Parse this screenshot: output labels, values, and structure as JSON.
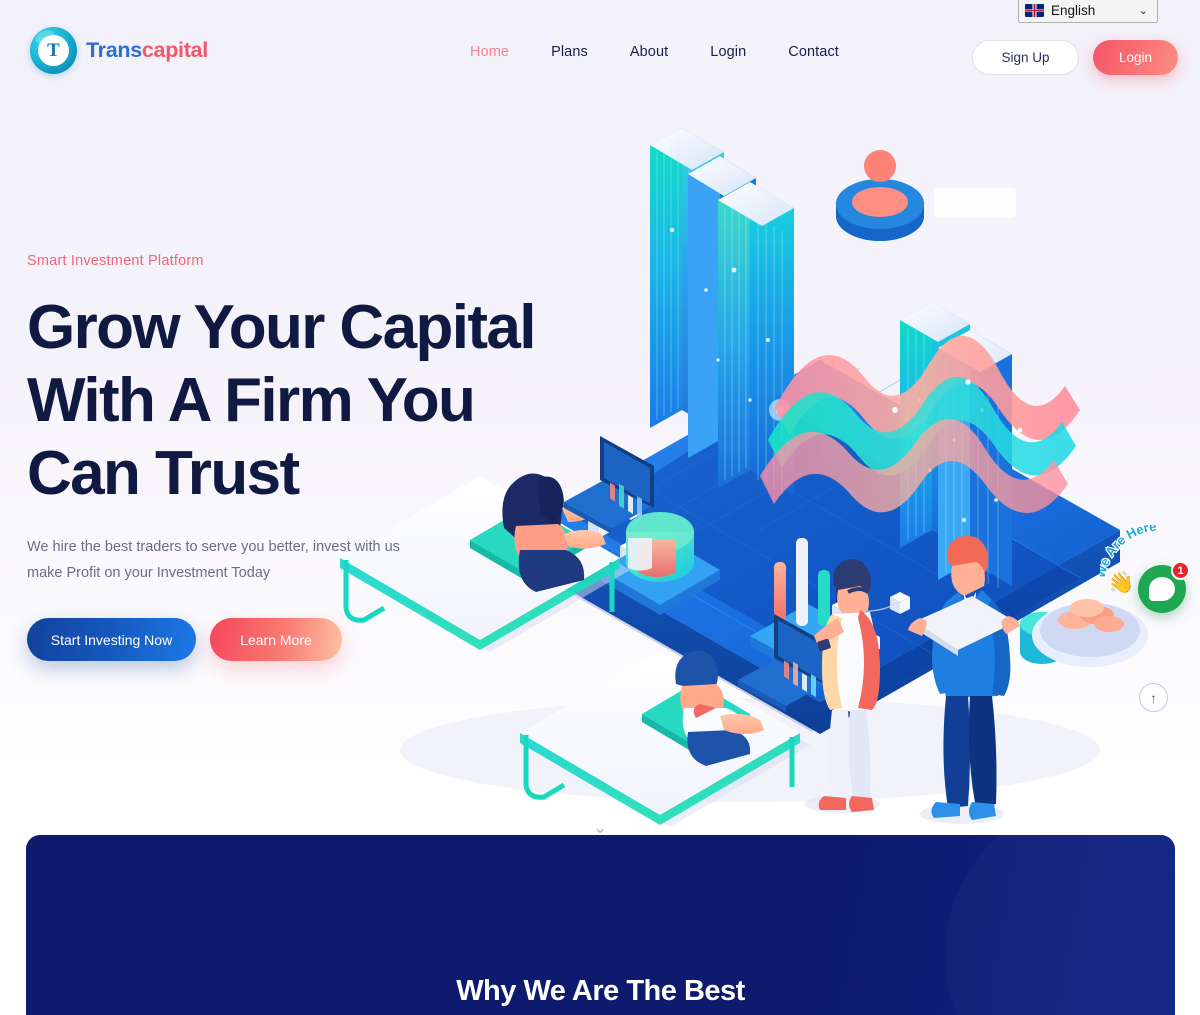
{
  "brand": {
    "mark_letter": "T",
    "name_part1": "Trans",
    "name_part2": "capital",
    "mark_color": "#17b4d4",
    "name_color1": "#2b6fd4",
    "name_color2": "#f2576a"
  },
  "nav": {
    "items": [
      {
        "label": "Home",
        "active": true
      },
      {
        "label": "Plans",
        "active": false
      },
      {
        "label": "About",
        "active": false
      },
      {
        "label": "Login",
        "active": false
      },
      {
        "label": "Contact",
        "active": false
      }
    ],
    "active_color": "#f7808f",
    "color": "#19204a"
  },
  "language": {
    "selected": "English",
    "flag": "uk-flag-icon",
    "chevron": "⌄"
  },
  "auth": {
    "signup_label": "Sign Up",
    "login_label": "Login",
    "login_gradient_from": "#f45668",
    "login_gradient_to": "#fb8f84"
  },
  "hero": {
    "eyebrow": "Smart Investment Platform",
    "eyebrow_color": "#f26579",
    "headline_line1": "Grow Your Capital",
    "headline_line2": "With A Firm You",
    "headline_line3": "Can Trust",
    "headline_color": "#101941",
    "subcopy": "We hire the best traders to serve you better, invest with us make Profit on your Investment Today",
    "primary_cta": "Start Investing Now",
    "secondary_cta": "Learn More",
    "primary_gradient_from": "#12419b",
    "primary_gradient_to": "#1c79e8",
    "secondary_gradient_from": "#f5455b",
    "secondary_gradient_to": "#fbc2a4"
  },
  "illustration": {
    "name": "isometric-investment-platform",
    "description": "Isometric blue platform with skyscrapers, 3D wave chart, bar and pie charts, people working at desks with laptops and two standing business figures"
  },
  "why_section": {
    "title": "Why We Are The Best",
    "background": "#0d1a6e",
    "title_color": "#ffffff"
  },
  "chat_widget": {
    "tooltip": "We Are Here",
    "badge_count": "1",
    "bubble_color": "#1fa851",
    "badge_color": "#e8242a",
    "hand_emoji": "👋"
  },
  "scroll_top": {
    "arrow": "↑"
  },
  "scroll_hint": {
    "chevron": "⌄"
  }
}
